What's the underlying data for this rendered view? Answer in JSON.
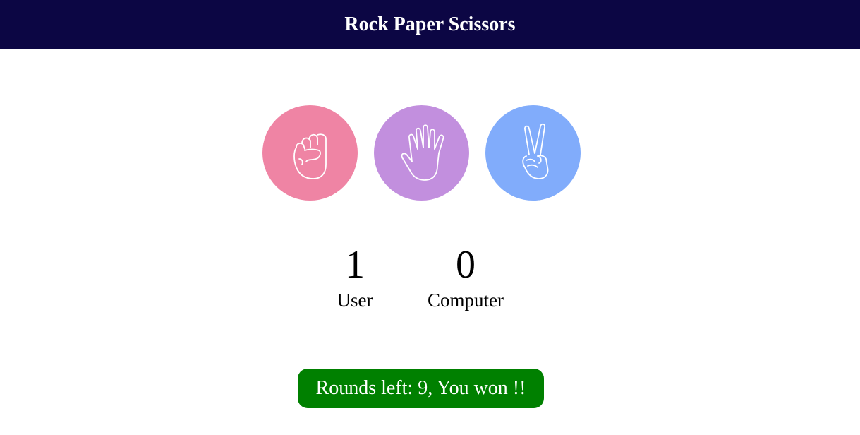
{
  "header": {
    "title": "Rock Paper Scissors"
  },
  "choices": [
    {
      "name": "rock",
      "icon": "fist-icon",
      "color": "#ef84a4"
    },
    {
      "name": "paper",
      "icon": "open-hand-icon",
      "color": "#c28fde"
    },
    {
      "name": "scissors",
      "icon": "peace-hand-icon",
      "color": "#81acfb"
    }
  ],
  "scoreboard": {
    "user": {
      "score": "1",
      "label": "User"
    },
    "computer": {
      "score": "0",
      "label": "Computer"
    }
  },
  "result": {
    "text": "Rounds left: 9, You won !!",
    "color": "#008000"
  },
  "colors": {
    "header_bg": "#0c0644"
  }
}
